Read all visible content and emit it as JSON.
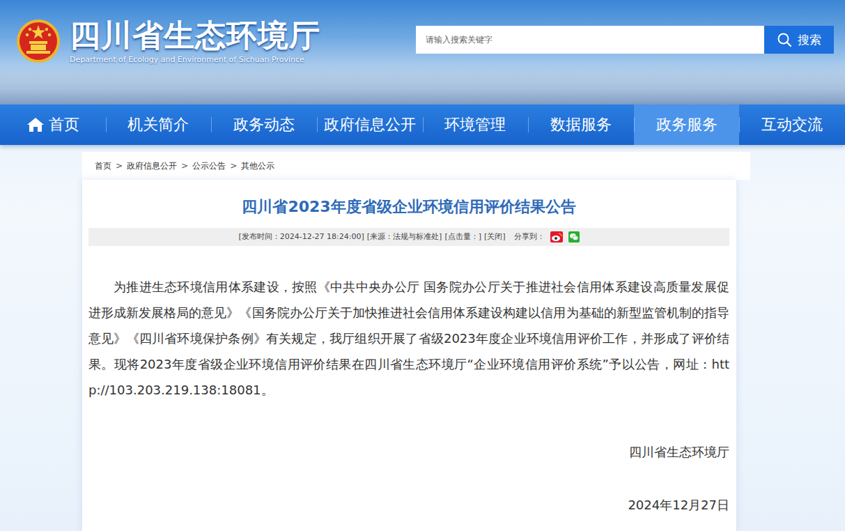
{
  "header": {
    "title": "四川省生态环境厅",
    "subtitle": "Department of Ecology and Environment of Sichuan Province"
  },
  "search": {
    "placeholder": "请输入搜索关键字",
    "button": "搜索"
  },
  "nav": [
    {
      "label": "首页",
      "selected": false,
      "kind": "home"
    },
    {
      "label": "机关简介",
      "selected": false,
      "kind": "text"
    },
    {
      "label": "政务动态",
      "selected": false,
      "kind": "text"
    },
    {
      "label": "政府信息公开",
      "selected": false,
      "kind": "text"
    },
    {
      "label": "环境管理",
      "selected": false,
      "kind": "text"
    },
    {
      "label": "数据服务",
      "selected": false,
      "kind": "text"
    },
    {
      "label": "政务服务",
      "selected": true,
      "kind": "text"
    },
    {
      "label": "互动交流",
      "selected": false,
      "kind": "text"
    }
  ],
  "breadcrumb": {
    "items": [
      "首页",
      "政府信息公开",
      "公示公告",
      "其他公示"
    ],
    "separator": ">"
  },
  "article": {
    "title": "四川省2023年度省级企业环境信用评价结果公告",
    "meta": [
      "[发布时间：2024-12-27 18:24:00]",
      "[来源：法规与标准处]",
      "[点击量：]",
      "[关闭]"
    ],
    "share_label": "分享到：",
    "paragraph": "为推进生态环境信用体系建设，按照《中共中央办公厅 国务院办公厅关于推进社会信用体系建设高质量发展促进形成新发展格局的意见》《国务院办公厅关于加快推进社会信用体系建设构建以信用为基础的新型监管机制的指导意见》《四川省环境保护条例》有关规定，我厅组织开展了省级2023年度企业环境信用评价工作，并形成了评价结果。现将2023年度省级企业环境信用评价结果在四川省生态环境厅“企业环境信用评价系统”予以公告，网址：http://103.203.219.138:18081。",
    "signature": "四川省生态环境厅",
    "date": "2024年12月27日"
  }
}
